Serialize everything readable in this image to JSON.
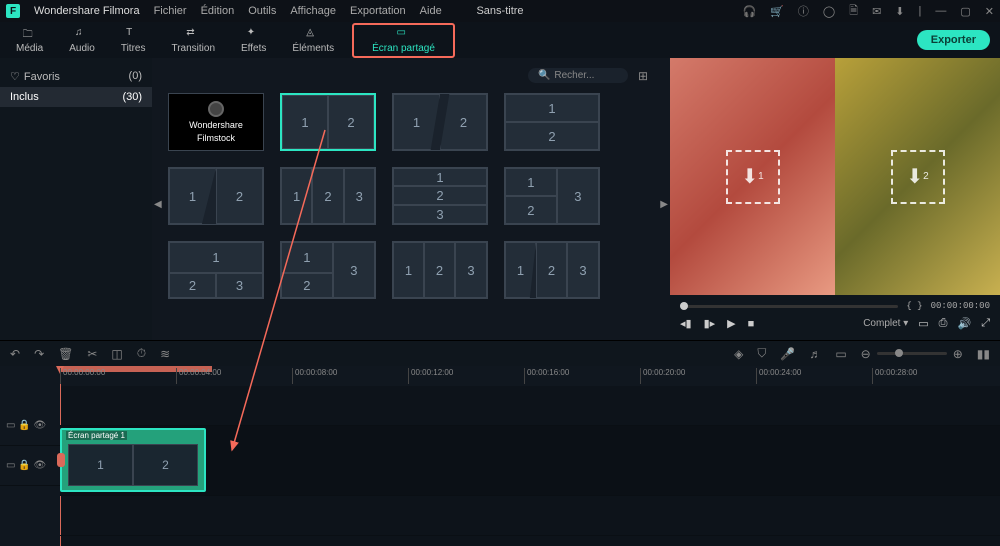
{
  "app": {
    "name": "Wondershare Filmora",
    "doc_title": "Sans-titre"
  },
  "menu": [
    "Fichier",
    "Édition",
    "Outils",
    "Affichage",
    "Exportation",
    "Aide"
  ],
  "window_icons": [
    "headset",
    "cart",
    "info",
    "user",
    "save",
    "mail",
    "download",
    "line",
    "min",
    "max",
    "close"
  ],
  "tabs": {
    "media": "Média",
    "audio": "Audio",
    "titles": "Titres",
    "transition": "Transition",
    "effects": "Effets",
    "elements": "Éléments",
    "split": "Écran partagé"
  },
  "export_btn": "Exporter",
  "sidebar": {
    "fav_label": "Favoris",
    "fav_count": "(0)",
    "incl_label": "Inclus",
    "incl_count": "(30)"
  },
  "search_placeholder": "Recher...",
  "filmstock": {
    "line1": "Wondershare",
    "line2": "Filmstock"
  },
  "preview": {
    "slot1": "1",
    "slot2": "2",
    "timecode_left": "{    }",
    "timecode_right": "00:00:00:00",
    "quality": "Complet"
  },
  "ruler_ticks": [
    "00:00:00:00",
    "00:00:04:00",
    "00:00:08:00",
    "00:00:12:00",
    "00:00:16:00",
    "00:00:20:00",
    "00:00:24:00",
    "00:00:28:00"
  ],
  "clip_label": "Écran partagé 1",
  "clip_cells": [
    "1",
    "2"
  ],
  "cells": {
    "n1": "1",
    "n2": "2",
    "n3": "3"
  }
}
